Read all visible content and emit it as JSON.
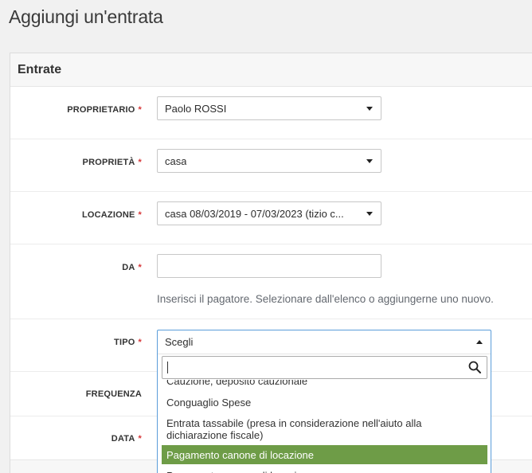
{
  "page": {
    "title": "Aggiungi un'entrata"
  },
  "panel": {
    "title": "Entrate"
  },
  "required_mark": "*",
  "fields": {
    "proprietario": {
      "label": "PROPRIETARIO",
      "value": "Paolo ROSSI"
    },
    "proprieta": {
      "label": "PROPRIETÀ",
      "value": "casa"
    },
    "locazione": {
      "label": "LOCAZIONE",
      "value": "casa 08/03/2019 - 07/03/2023 (tizio c..."
    },
    "da": {
      "label": "DA",
      "value": "",
      "hint": "Inserisci il pagatore. Selezionare dall'elenco o aggiungerne uno nuovo."
    },
    "tipo": {
      "label": "TIPO",
      "value": "Scegli"
    },
    "frequenza": {
      "label": "FREQUENZA"
    },
    "data": {
      "label": "DATA"
    }
  },
  "dropdown": {
    "search_value": "",
    "options": [
      "Cauzione, deposito cauzionale",
      "Conguaglio Spese",
      "Entrata tassabile (presa in considerazione nell'aiuto alla dichiarazione fiscale)",
      "Pagamento canone di locazione",
      "Pagamento canone di locazione"
    ],
    "highlighted_index": 3
  },
  "colors": {
    "accent": "#6e9c47",
    "focus": "#5b9dd9",
    "required": "#d63638"
  }
}
